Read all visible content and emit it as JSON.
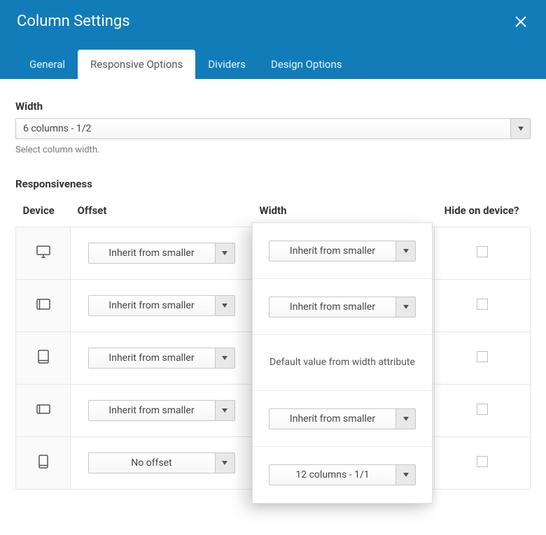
{
  "header": {
    "title": "Column Settings"
  },
  "tabs": [
    {
      "label": "General",
      "active": false
    },
    {
      "label": "Responsive Options",
      "active": true
    },
    {
      "label": "Dividers",
      "active": false
    },
    {
      "label": "Design Options",
      "active": false
    }
  ],
  "width_field": {
    "label": "Width",
    "value": "6 columns - 1/2",
    "helper": "Select column width."
  },
  "responsiveness": {
    "label": "Responsiveness",
    "columns": {
      "device": "Device",
      "offset": "Offset",
      "width": "Width",
      "hide": "Hide on device?"
    },
    "rows": [
      {
        "device": "desktop",
        "offset": "Inherit from smaller"
      },
      {
        "device": "tablet-landscape",
        "offset": "Inherit from smaller"
      },
      {
        "device": "tablet-portrait",
        "offset": "Inherit from smaller"
      },
      {
        "device": "phone-landscape",
        "offset": "Inherit from smaller"
      },
      {
        "device": "phone-portrait",
        "offset": "No offset"
      }
    ],
    "width_overlay": [
      {
        "type": "select",
        "value": "Inherit from smaller"
      },
      {
        "type": "select",
        "value": "Inherit from smaller"
      },
      {
        "type": "text",
        "value": "Default value from width attribute"
      },
      {
        "type": "select",
        "value": "Inherit from smaller"
      },
      {
        "type": "select",
        "value": "12 columns - 1/1"
      }
    ]
  }
}
